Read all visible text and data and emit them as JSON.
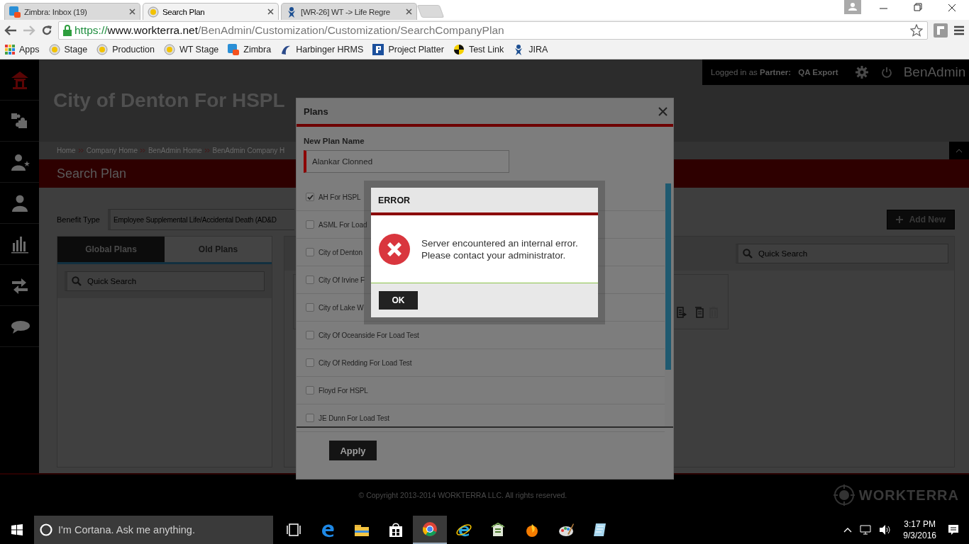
{
  "browser": {
    "tabs": [
      {
        "title": "Zimbra: Inbox (19)",
        "kind": "tile",
        "selected": false
      },
      {
        "title": "Search Plan",
        "kind": "badge",
        "selected": true
      },
      {
        "title": "[WR-26] WT -> Life Regre",
        "kind": "figure",
        "selected": false
      }
    ],
    "url": {
      "scheme": "https://",
      "host": "www.workterra.net",
      "path": "/BenAdmin/Customization/Customization/SearchCompanyPlan"
    },
    "bookmarks": [
      {
        "label": "Apps",
        "kind": "grid"
      },
      {
        "label": "Stage",
        "kind": "badge"
      },
      {
        "label": "Production",
        "kind": "badge"
      },
      {
        "label": "WT Stage",
        "kind": "badge"
      },
      {
        "label": "Zimbra",
        "kind": "tile"
      },
      {
        "label": "Harbinger HRMS",
        "kind": "swirl"
      },
      {
        "label": "Project Platter",
        "kind": "square"
      },
      {
        "label": "Test Link",
        "kind": "target"
      },
      {
        "label": "JIRA",
        "kind": "figure"
      }
    ]
  },
  "sidebar": {
    "items": [
      {
        "kind": "home",
        "selected": true
      },
      {
        "kind": "puzzle",
        "selected": false
      },
      {
        "kind": "user-star",
        "selected": false
      },
      {
        "kind": "user",
        "selected": false
      },
      {
        "kind": "chart",
        "selected": false
      },
      {
        "kind": "transfer",
        "selected": false
      },
      {
        "kind": "chat",
        "selected": false
      }
    ]
  },
  "header": {
    "company": "City of Denton For HSPL",
    "logged_in_label": "Logged in as",
    "role": "Partner:",
    "user": "QA Export",
    "app_name": "BenAdmin"
  },
  "breadcrumbs": [
    "Home",
    "Company Home",
    "BenAdmin Home",
    "BenAdmin Company H"
  ],
  "page_title": "Search Plan",
  "filter": {
    "label": "Benefit Type",
    "value": "Employee Supplemental Life/Accidental Death (AD&D"
  },
  "add_new": "Add New",
  "plan_tabs": [
    {
      "label": "Global Plans",
      "selected": true
    },
    {
      "label": "Old Plans",
      "selected": false
    }
  ],
  "left_search": {
    "placeholder": "Quick Search"
  },
  "right_search": {
    "placeholder": "Quick Search"
  },
  "plans_modal": {
    "title": "Plans",
    "name_label": "New Plan Name",
    "name_value": "Alankar Clonned",
    "plans": [
      {
        "name": "AH For HSPL",
        "checked": true
      },
      {
        "name": "ASML For Load",
        "checked": false
      },
      {
        "name": "City of Denton",
        "checked": false
      },
      {
        "name": "City Of Irvine F",
        "checked": false
      },
      {
        "name": "City of Lake W",
        "checked": false
      },
      {
        "name": "City Of Oceanside For Load Test",
        "checked": false
      },
      {
        "name": "City Of Redding For Load Test",
        "checked": false
      },
      {
        "name": "Floyd For HSPL",
        "checked": false
      },
      {
        "name": "JE Dunn For Load Test",
        "checked": false
      }
    ],
    "apply": "Apply"
  },
  "error_dialog": {
    "title": "ERROR",
    "message_lines": [
      "Server encountered an internal error.",
      "Please contact your administrator."
    ],
    "ok": "OK"
  },
  "footer": {
    "copyright": "© Copyright 2013-2014 WORKTERRA LLC. All rights reserved.",
    "brand": "WORKTERRA"
  },
  "taskbar": {
    "search": {
      "placeholder": "I'm Cortana. Ask me anything."
    },
    "apps": [
      {
        "kind": "taskview",
        "selected": false
      },
      {
        "kind": "edge",
        "selected": false
      },
      {
        "kind": "folder",
        "selected": false
      },
      {
        "kind": "store",
        "selected": false
      },
      {
        "kind": "chrome",
        "selected": true
      },
      {
        "kind": "ie",
        "selected": false
      },
      {
        "kind": "sheet",
        "selected": false
      },
      {
        "kind": "flame",
        "selected": false
      },
      {
        "kind": "palette",
        "selected": false
      },
      {
        "kind": "notepad",
        "selected": false
      }
    ],
    "time": "3:17 PM",
    "date": "9/3/2016"
  }
}
